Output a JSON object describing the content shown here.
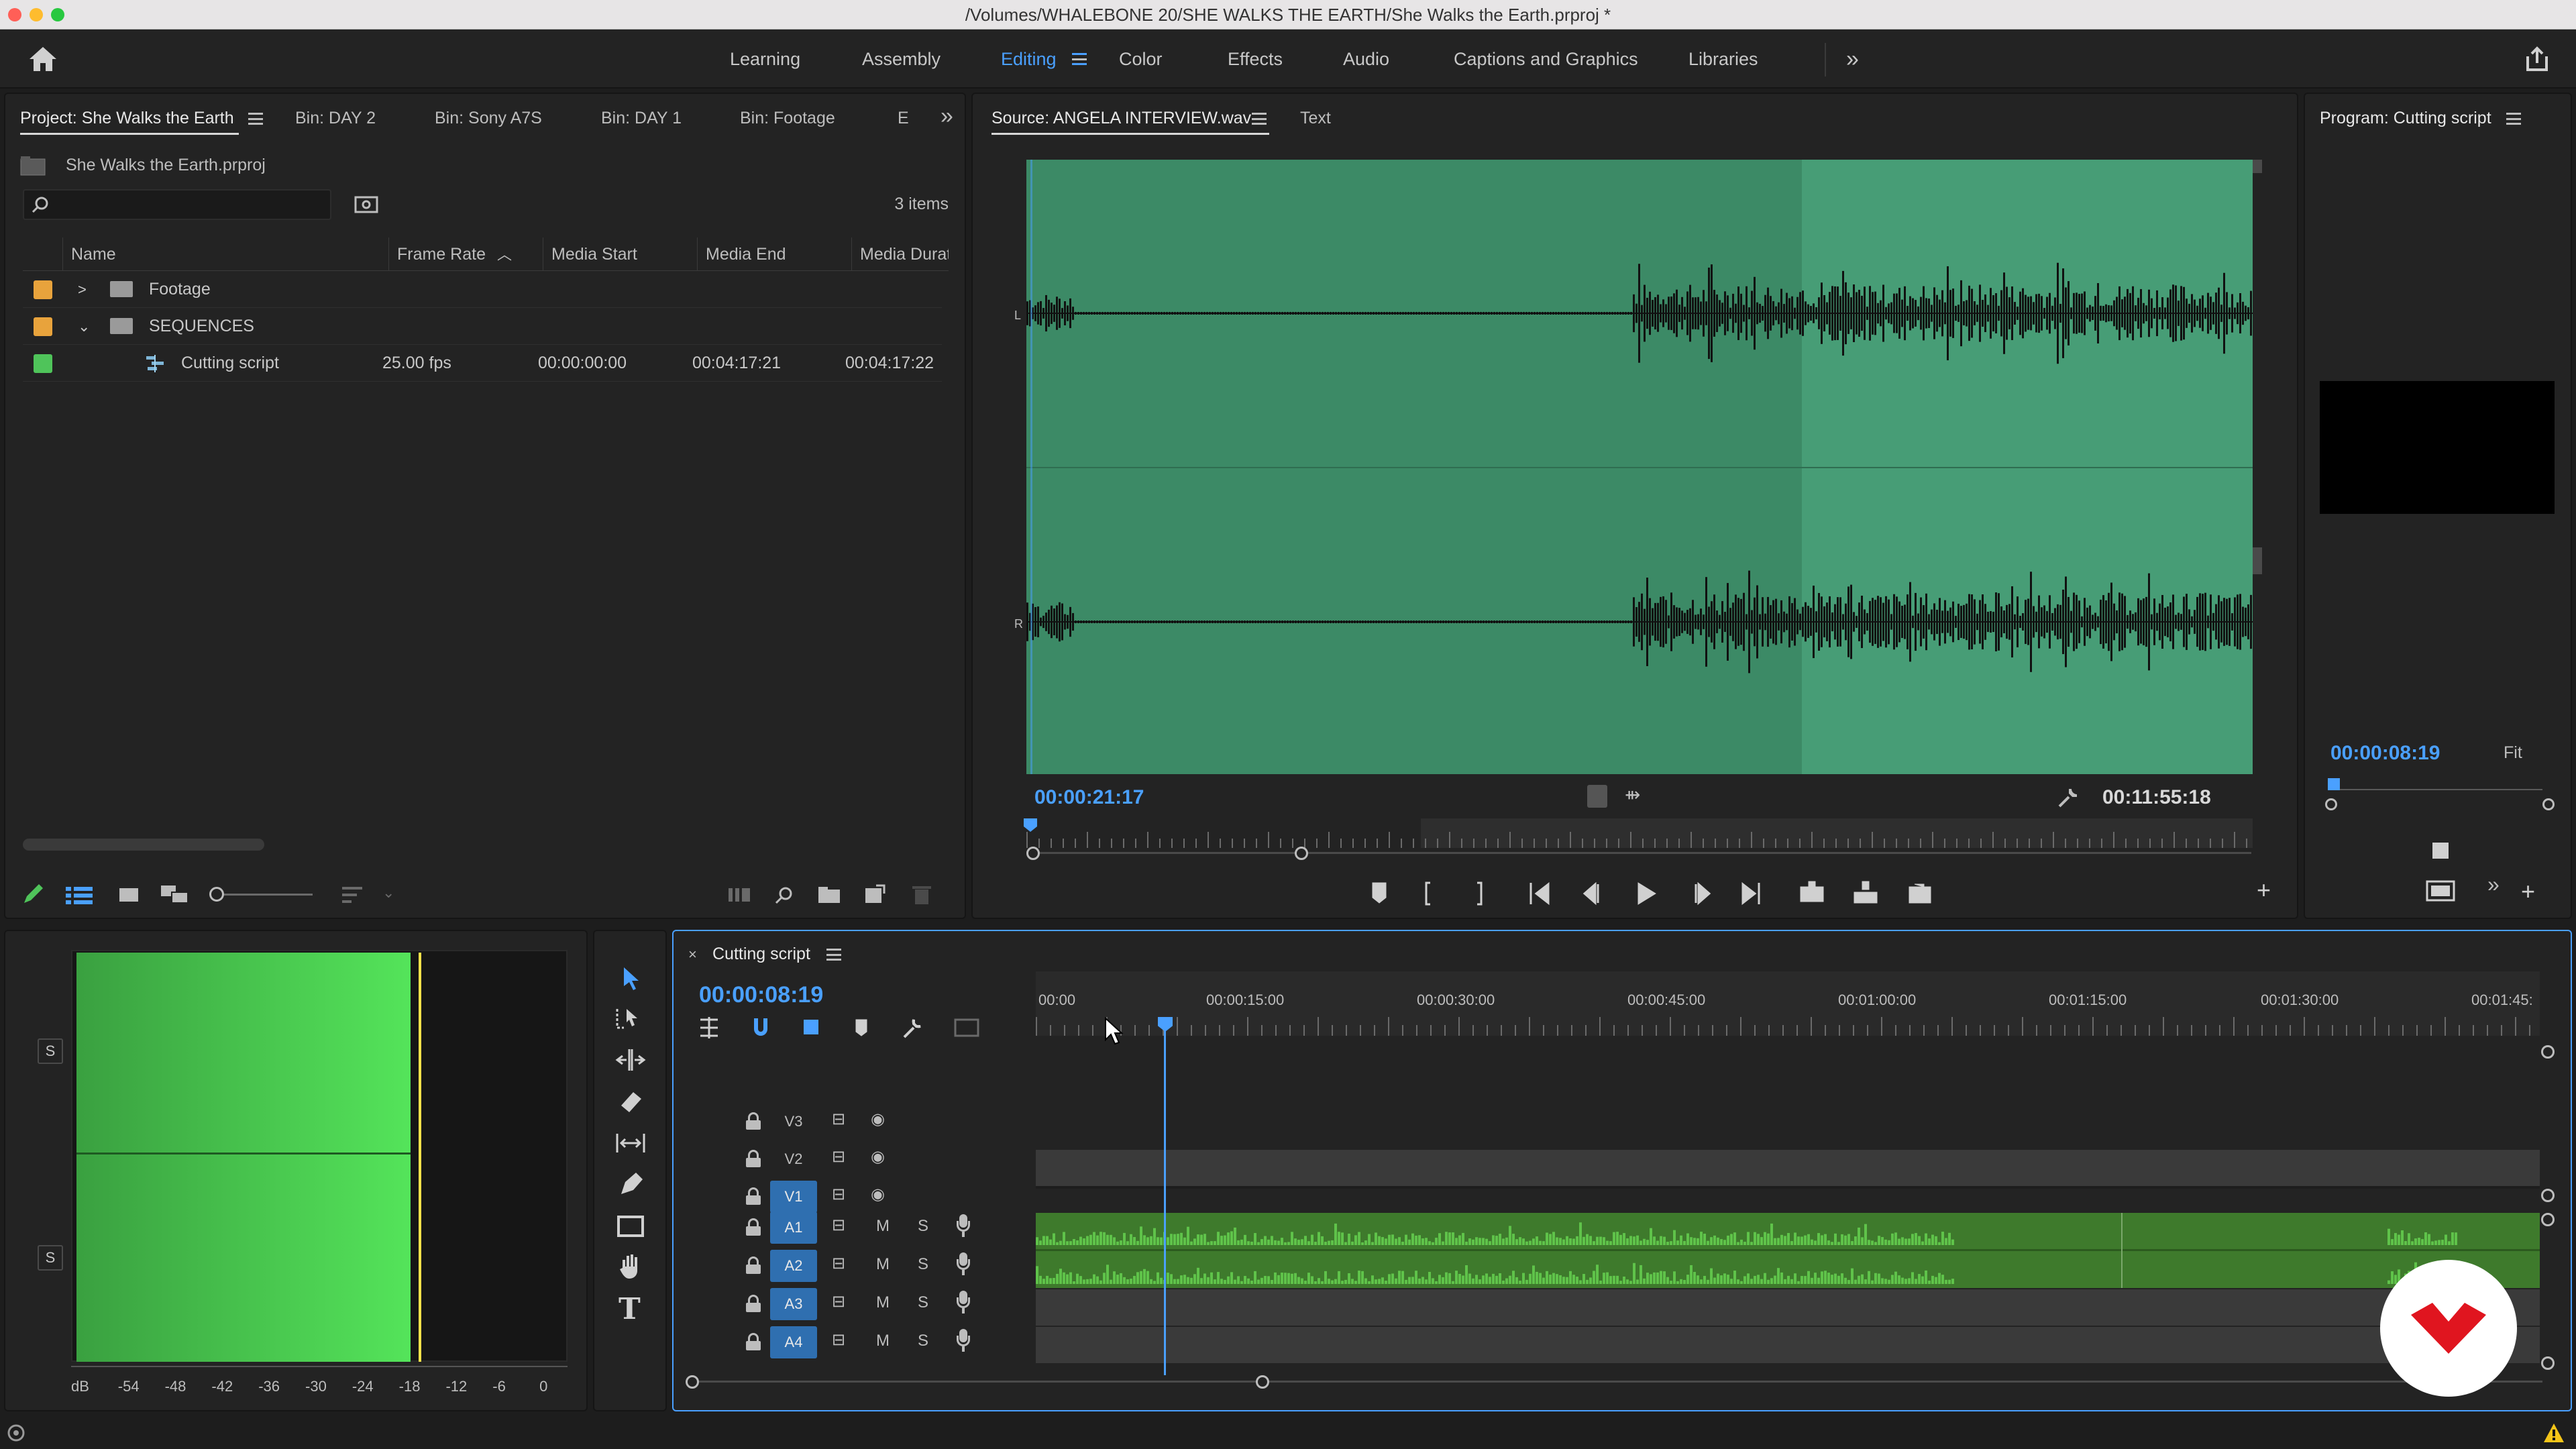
{
  "window": {
    "title": "/Volumes/WHALEBONE 20/SHE WALKS THE EARTH/She Walks the Earth.prproj *"
  },
  "workspaces": {
    "tabs": [
      "Learning",
      "Assembly",
      "Editing",
      "Color",
      "Effects",
      "Audio",
      "Captions and Graphics",
      "Libraries"
    ],
    "active": "Editing"
  },
  "project_panel": {
    "tabs": [
      "Project: She Walks the Earth",
      "Bin: DAY 2",
      "Bin: Sony A7S",
      "Bin: DAY 1",
      "Bin: Footage",
      "E"
    ],
    "file_name": "She Walks the Earth.prproj",
    "search_placeholder": "",
    "item_count": "3 items",
    "columns": [
      "Name",
      "Frame Rate",
      "Media Start",
      "Media End",
      "Media Duration"
    ],
    "rows": [
      {
        "name": "Footage",
        "frame_rate": "",
        "media_start": "",
        "media_end": "",
        "media_duration": "",
        "color": "#e8a33c"
      },
      {
        "name": "SEQUENCES",
        "frame_rate": "",
        "media_start": "",
        "media_end": "",
        "media_duration": "",
        "color": "#e8a33c"
      },
      {
        "name": "Cutting script",
        "frame_rate": "25.00 fps",
        "media_start": "00:00:00:00",
        "media_end": "00:04:17:21",
        "media_duration": "00:04:17:22",
        "color": "#4fc45a"
      }
    ]
  },
  "source_monitor": {
    "tabs": [
      "Source: ANGELA INTERVIEW.wav",
      "Text"
    ],
    "timecode_current": "00:00:21:17",
    "timecode_duration": "00:11:55:18",
    "channel_left": "L",
    "channel_right": "R",
    "waveform_color": "#3c8a66",
    "waveform_highlight": "#479d76"
  },
  "program_monitor": {
    "title": "Program: Cutting script",
    "timecode": "00:00:08:19",
    "zoom": "Fit"
  },
  "audio_meter": {
    "scale": [
      "dB",
      "-54",
      "-48",
      "-42",
      "-36",
      "-30",
      "-24",
      "-18",
      "-12",
      "-6",
      "0"
    ],
    "solo_labels": [
      "S",
      "S"
    ]
  },
  "timeline": {
    "sequence_name": "Cutting script",
    "timecode": "00:00:08:19",
    "ruler": [
      "00:00",
      "00:00:15:00",
      "00:00:30:00",
      "00:00:45:00",
      "00:01:00:00",
      "00:01:15:00",
      "00:01:30:00",
      "00:01:45:"
    ],
    "video_tracks": [
      "V3",
      "V2",
      "V1"
    ],
    "audio_tracks": [
      "A1",
      "A2",
      "A3",
      "A4"
    ],
    "mute_label": "M",
    "solo_label": "S",
    "audio_clip_color": "#3e7a2c"
  },
  "tools": [
    "selection-tool",
    "track-select-tool",
    "ripple-edit-tool",
    "razor-tool",
    "slip-tool",
    "pen-tool",
    "rectangle-tool",
    "hand-tool",
    "type-tool"
  ],
  "colors": {
    "accent_blue": "#4aa0ff",
    "panel_bg": "#232323",
    "app_bg": "#1d1d1d"
  }
}
